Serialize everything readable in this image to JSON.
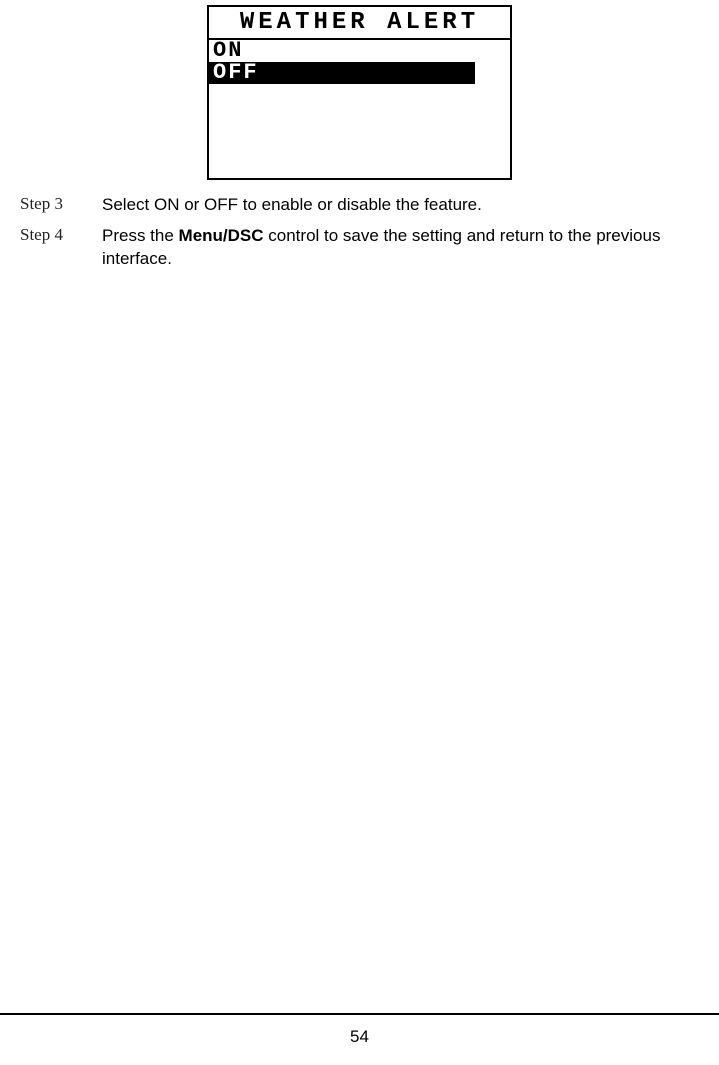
{
  "screen": {
    "title": "WEATHER ALERT",
    "options": {
      "on": "ON",
      "off": "OFF"
    },
    "selected": "off"
  },
  "steps": {
    "step3": {
      "label": "Step 3",
      "text": "Select ON or OFF to enable or disable the feature."
    },
    "step4": {
      "label": "Step 4",
      "text_before": "Press the ",
      "bold": "Menu/DSC",
      "text_after": " control to save the setting and return to the previous interface."
    }
  },
  "page_number": "54"
}
